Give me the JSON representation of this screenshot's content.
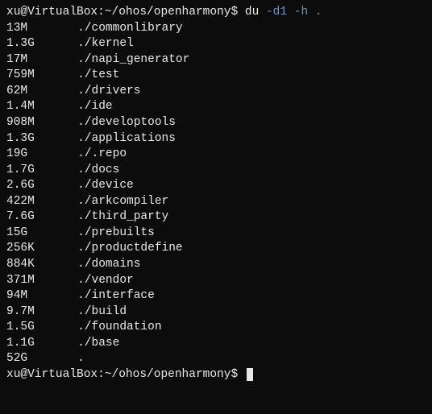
{
  "prompt": {
    "user_host": "xu@VirtualBox",
    "sep1": ":",
    "path": "~/ohos/openharmony",
    "sep2": "$",
    "cmd": "du",
    "flag1": "-d1",
    "flag2": "-h",
    "arg": "."
  },
  "rows": [
    {
      "size": "13M",
      "entry": "./commonlibrary"
    },
    {
      "size": "1.3G",
      "entry": "./kernel"
    },
    {
      "size": "17M",
      "entry": "./napi_generator"
    },
    {
      "size": "759M",
      "entry": "./test"
    },
    {
      "size": "62M",
      "entry": "./drivers"
    },
    {
      "size": "1.4M",
      "entry": "./ide"
    },
    {
      "size": "908M",
      "entry": "./developtools"
    },
    {
      "size": "1.3G",
      "entry": "./applications"
    },
    {
      "size": "19G",
      "entry": "./.repo"
    },
    {
      "size": "1.7G",
      "entry": "./docs"
    },
    {
      "size": "2.6G",
      "entry": "./device"
    },
    {
      "size": "422M",
      "entry": "./arkcompiler"
    },
    {
      "size": "7.6G",
      "entry": "./third_party"
    },
    {
      "size": "15G",
      "entry": "./prebuilts"
    },
    {
      "size": "256K",
      "entry": "./productdefine"
    },
    {
      "size": "884K",
      "entry": "./domains"
    },
    {
      "size": "371M",
      "entry": "./vendor"
    },
    {
      "size": "94M",
      "entry": "./interface"
    },
    {
      "size": "9.7M",
      "entry": "./build"
    },
    {
      "size": "1.5G",
      "entry": "./foundation"
    },
    {
      "size": "1.1G",
      "entry": "./base"
    },
    {
      "size": "52G",
      "entry": "."
    }
  ],
  "prompt2": {
    "user_host": "xu@VirtualBox",
    "sep1": ":",
    "path": "~/ohos/openharmony",
    "sep2": "$"
  }
}
